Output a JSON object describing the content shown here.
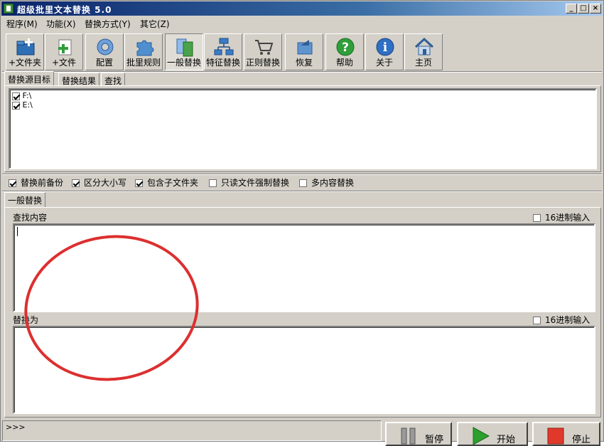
{
  "window": {
    "title": "超级批里文本替换 5.0",
    "controls": [
      "_",
      "□",
      "×"
    ]
  },
  "menu": [
    "程序(M)",
    "功能(X)",
    "替换方式(Y)",
    "其它(Z)"
  ],
  "toolbar": [
    {
      "label": "+文件夹",
      "icon": "add-folder-icon"
    },
    {
      "label": "+文件",
      "icon": "add-file-icon"
    },
    {
      "label": "配置",
      "icon": "config-gear-icon"
    },
    {
      "label": "批里规则",
      "icon": "puzzle-icon"
    },
    {
      "label": "一般替换",
      "icon": "general-replace-icon"
    },
    {
      "label": "特征替换",
      "icon": "network-icon"
    },
    {
      "label": "正则替换",
      "icon": "cart-icon"
    },
    {
      "label": "恢复",
      "icon": "restore-icon"
    },
    {
      "label": "帮助",
      "icon": "help-icon"
    },
    {
      "label": "关于",
      "icon": "info-icon"
    },
    {
      "label": "主页",
      "icon": "home-icon"
    }
  ],
  "source_tabs": [
    "替换源目标",
    "替换结果",
    "查找"
  ],
  "source_list": [
    {
      "path": "F:\\",
      "checked": true
    },
    {
      "path": "E:\\",
      "checked": true
    }
  ],
  "options": [
    {
      "label": "替换前备份",
      "checked": true
    },
    {
      "label": "区分大小写",
      "checked": true
    },
    {
      "label": "包含子文件夹",
      "checked": true
    },
    {
      "label": "只读文件强制替换",
      "checked": false
    },
    {
      "label": "多内容替换",
      "checked": false
    }
  ],
  "mode_tab": "一般替换",
  "find": {
    "label": "查找内容",
    "hex_label": "16进制输入",
    "value": ""
  },
  "replace": {
    "label": "替换为",
    "hex_label": "16进制输入",
    "value": ""
  },
  "status": {
    "text": ">>>"
  },
  "buttons": {
    "pause": "暂停",
    "start": "开始",
    "stop": "停止"
  },
  "colors": {
    "annotation": "#dd2f2f",
    "start": "#2ca02c",
    "stop": "#e0392b"
  }
}
